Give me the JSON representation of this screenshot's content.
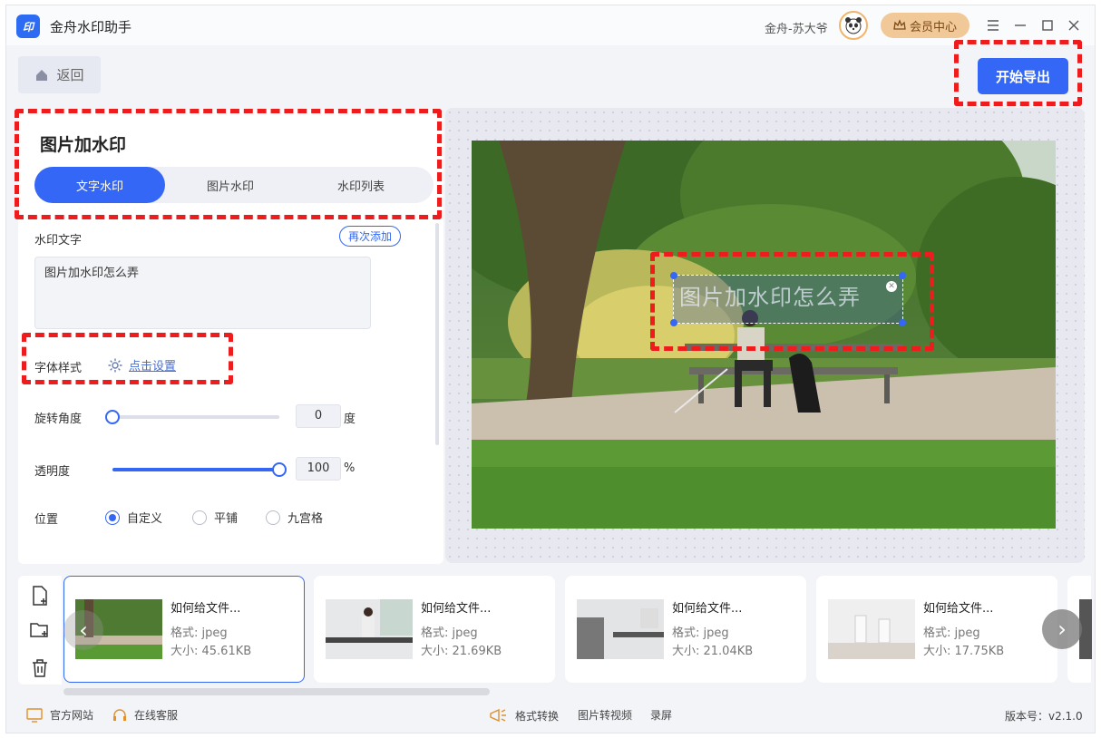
{
  "app": {
    "title": "金舟水印助手",
    "logo_text": "印",
    "username": "金舟-苏大爷",
    "vip_label": "会员中心"
  },
  "toolbar": {
    "back_label": "返回",
    "export_label": "开始导出"
  },
  "panel": {
    "title": "图片加水印",
    "tabs": [
      {
        "label": "文字水印",
        "active": true
      },
      {
        "label": "图片水印",
        "active": false
      },
      {
        "label": "水印列表",
        "active": false
      }
    ],
    "watermark_text_label": "水印文字",
    "readd_label": "再次添加",
    "watermark_text_value": "图片加水印怎么弄",
    "font_style_label": "字体样式",
    "font_style_link": "点击设置",
    "rotation": {
      "label": "旋转角度",
      "value": "0",
      "unit": "度",
      "fraction": 0
    },
    "opacity": {
      "label": "透明度",
      "value": "100",
      "unit": "%",
      "fraction": 1
    },
    "position": {
      "label": "位置",
      "options": [
        {
          "label": "自定义",
          "selected": true
        },
        {
          "label": "平铺",
          "selected": false
        },
        {
          "label": "九宫格",
          "selected": false
        }
      ]
    }
  },
  "preview": {
    "watermark_text": "图片加水印怎么弄"
  },
  "files": [
    {
      "name": "如何给文件...",
      "format": "格式: jpeg",
      "size": "大小: 45.61KB",
      "active": true
    },
    {
      "name": "如何给文件...",
      "format": "格式: jpeg",
      "size": "大小: 21.69KB",
      "active": false
    },
    {
      "name": "如何给文件...",
      "format": "格式: jpeg",
      "size": "大小: 21.04KB",
      "active": false
    },
    {
      "name": "如何给文件...",
      "format": "格式: jpeg",
      "size": "大小: 17.75KB",
      "active": false
    }
  ],
  "footer": {
    "website": "官方网站",
    "support": "在线客服",
    "format_convert": "格式转换",
    "image_to_video": "图片转视频",
    "record": "录屏",
    "version": "版本号：v2.1.0"
  },
  "colors": {
    "accent": "#3467f5",
    "annotation": "#ee1c1c",
    "vip": "#f1c898"
  }
}
